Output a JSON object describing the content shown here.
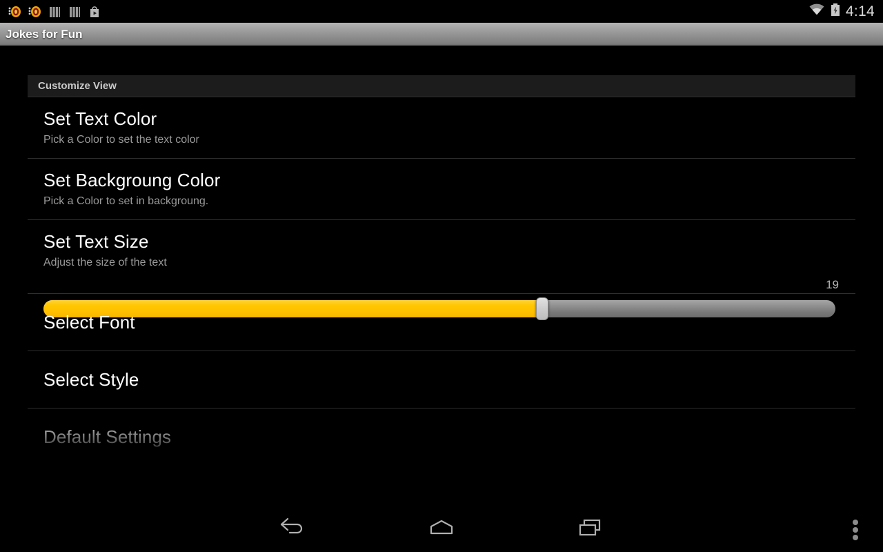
{
  "statusbar": {
    "notification_icons": [
      "joke-mask-icon",
      "joke-mask-icon",
      "bars-icon",
      "bars-icon",
      "play-store-icon"
    ],
    "wifi_icon": "wifi-icon",
    "battery_icon": "battery-charging-icon",
    "time": "4:14"
  },
  "actionbar": {
    "title": "Jokes for Fun"
  },
  "preferences": {
    "section_header": "Customize View",
    "items": [
      {
        "title": "Set Text Color",
        "summary": "Pick a Color to set the text color"
      },
      {
        "title": "Set Backgroung Color",
        "summary": "Pick a Color to set in backgroung."
      },
      {
        "title": "Set Text Size",
        "summary": "Adjust the size of the text"
      },
      {
        "title": "Select Font",
        "summary": ""
      },
      {
        "title": "Select Style",
        "summary": ""
      },
      {
        "title": "Default Settings",
        "summary": ""
      }
    ]
  },
  "text_size_slider": {
    "value": "19",
    "min": 0,
    "max": 30,
    "fill_percent": 63,
    "fill_color": "#ffc800",
    "track_color": "#8f8f8f"
  },
  "navbar": {
    "back_label": "back-icon",
    "home_label": "home-icon",
    "recents_label": "recents-icon",
    "overflow_label": "overflow-menu-icon"
  }
}
